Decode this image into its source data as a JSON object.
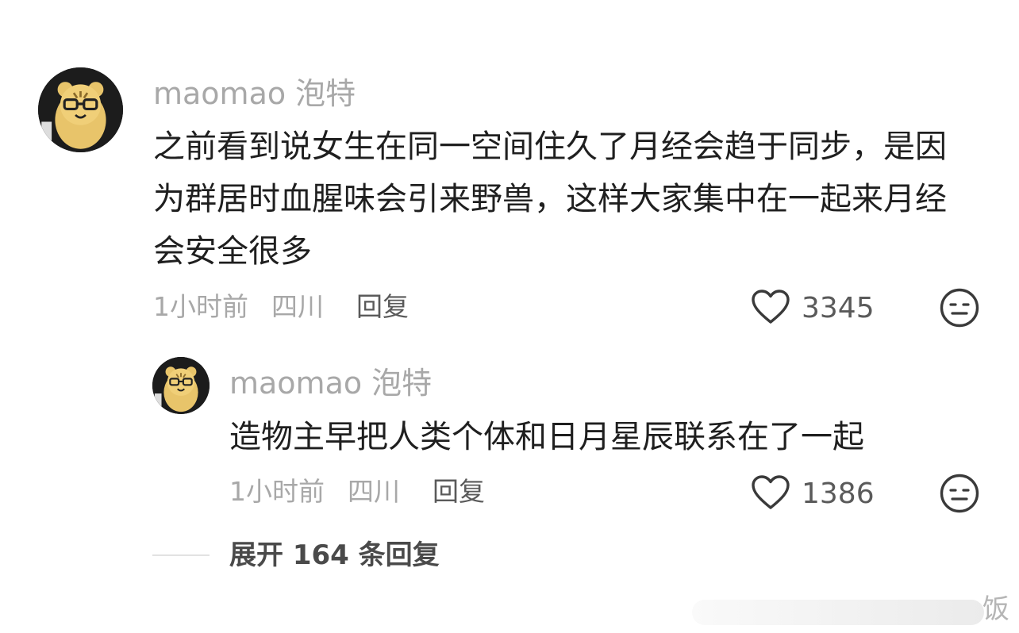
{
  "comment": {
    "username": "maomao 泡特",
    "text": "之前看到说女生在同一空间住久了月经会趋于同步，是因\n为群居时血腥味会引来野兽，这样大家集中在一起来月经\n会安全很多",
    "time": "1小时前",
    "location": "四川",
    "reply_label": "回复",
    "likes": "3345"
  },
  "reply": {
    "username": "maomao 泡特",
    "text": "造物主早把人类个体和日月星辰联系在了一起",
    "time": "1小时前",
    "location": "四川",
    "reply_label": "回复",
    "likes": "1386"
  },
  "expand_label": "展开 164 条回复",
  "icons": {
    "like": "heart-outline-icon",
    "dislike": "meh-face-icon"
  },
  "colors": {
    "text_primary": "#1f1f1f",
    "text_secondary": "#a8a8a8",
    "avatar_bg": "#1c1c1c",
    "avatar_character": "#e8c46a"
  },
  "watermark_text": "饭"
}
